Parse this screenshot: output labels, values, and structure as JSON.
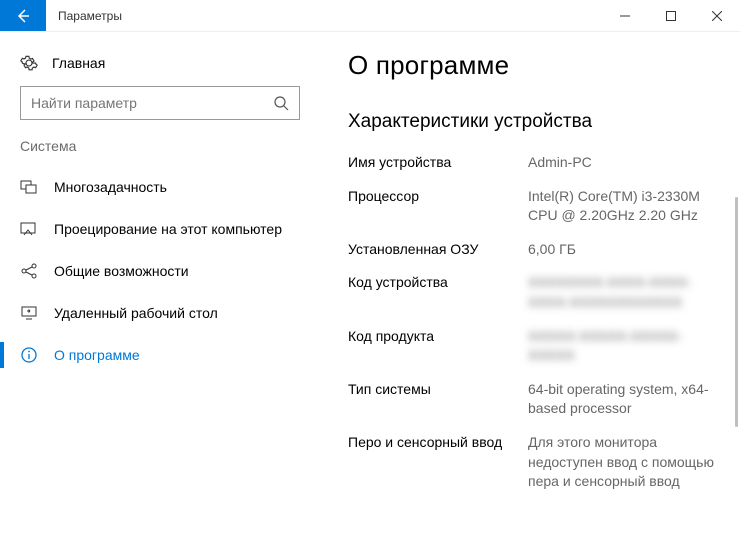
{
  "titlebar": {
    "title": "Параметры"
  },
  "sidebar": {
    "home_label": "Главная",
    "search_placeholder": "Найти параметр",
    "group_label": "Система",
    "items": [
      {
        "label": "Многозадачность"
      },
      {
        "label": "Проецирование на этот компьютер"
      },
      {
        "label": "Общие возможности"
      },
      {
        "label": "Удаленный рабочий стол"
      },
      {
        "label": "О программе"
      }
    ]
  },
  "main": {
    "page_title": "О программе",
    "section_title": "Характеристики устройства",
    "specs": {
      "device_name_label": "Имя устройства",
      "device_name_value": "Admin-PC",
      "processor_label": "Процессор",
      "processor_value": "Intel(R) Core(TM) i3-2330M CPU @ 2.20GHz 2.20 GHz",
      "ram_label": "Установленная ОЗУ",
      "ram_value": "6,00 ГБ",
      "device_id_label": "Код устройства",
      "device_id_value": "XXXXXXXX-XXXX-XXXX-XXXX-XXXXXXXXXXXX",
      "product_id_label": "Код продукта",
      "product_id_value": "XXXXX-XXXXX-XXXXX-XXXXX",
      "system_type_label": "Тип системы",
      "system_type_value": "64-bit operating system, x64-based processor",
      "pen_touch_label": "Перо и сенсорный ввод",
      "pen_touch_value": "Для этого монитора недоступен ввод с помощью пера и сенсорный ввод"
    }
  }
}
